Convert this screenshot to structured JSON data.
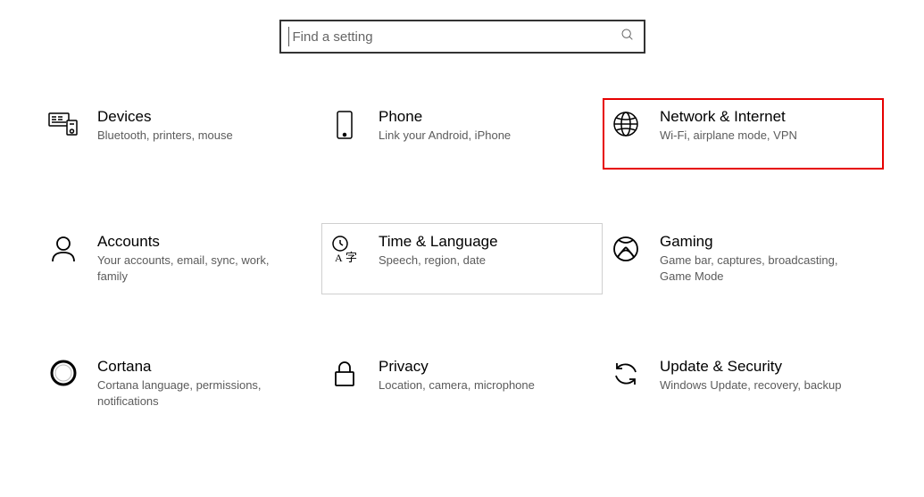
{
  "search": {
    "placeholder": "Find a setting"
  },
  "tiles": {
    "devices": {
      "title": "Devices",
      "desc": "Bluetooth, printers, mouse"
    },
    "phone": {
      "title": "Phone",
      "desc": "Link your Android, iPhone"
    },
    "network": {
      "title": "Network & Internet",
      "desc": "Wi-Fi, airplane mode, VPN"
    },
    "accounts": {
      "title": "Accounts",
      "desc": "Your accounts, email, sync, work, family"
    },
    "time": {
      "title": "Time & Language",
      "desc": "Speech, region, date"
    },
    "gaming": {
      "title": "Gaming",
      "desc": "Game bar, captures, broadcasting, Game Mode"
    },
    "cortana": {
      "title": "Cortana",
      "desc": "Cortana language, permissions, notifications"
    },
    "privacy": {
      "title": "Privacy",
      "desc": "Location, camera, microphone"
    },
    "update": {
      "title": "Update & Security",
      "desc": "Windows Update, recovery, backup"
    }
  }
}
